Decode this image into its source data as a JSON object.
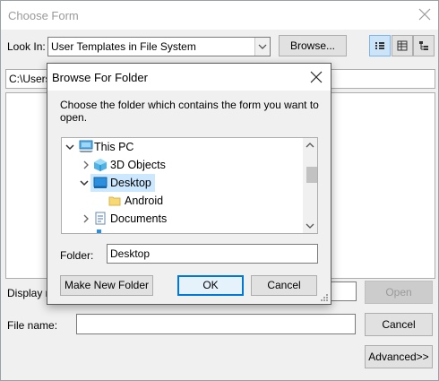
{
  "choose_form": {
    "title": "Choose Form",
    "look_in_label": "Look In:",
    "look_in_value": "User Templates in File System",
    "browse_label": "Browse...",
    "path_text": "C:\\Users\\",
    "display_name_label": "Display n",
    "open_label": "Open",
    "file_name_label": "File name:",
    "file_name_value": "",
    "cancel_label": "Cancel",
    "advanced_label": "Advanced>>"
  },
  "browse_folder": {
    "title": "Browse For Folder",
    "instruction": "Choose the folder which contains the form you want to open.",
    "tree": {
      "this_pc": "This PC",
      "objects3d": "3D Objects",
      "desktop": "Desktop",
      "android": "Android",
      "documents": "Documents"
    },
    "folder_label": "Folder:",
    "folder_value": "Desktop",
    "new_folder_label": "Make New Folder",
    "ok_label": "OK",
    "cancel_label": "Cancel"
  },
  "colors": {
    "selection": "#cce8ff",
    "accent_border": "#0078d7",
    "dialog_bg": "#f0f0f0"
  }
}
